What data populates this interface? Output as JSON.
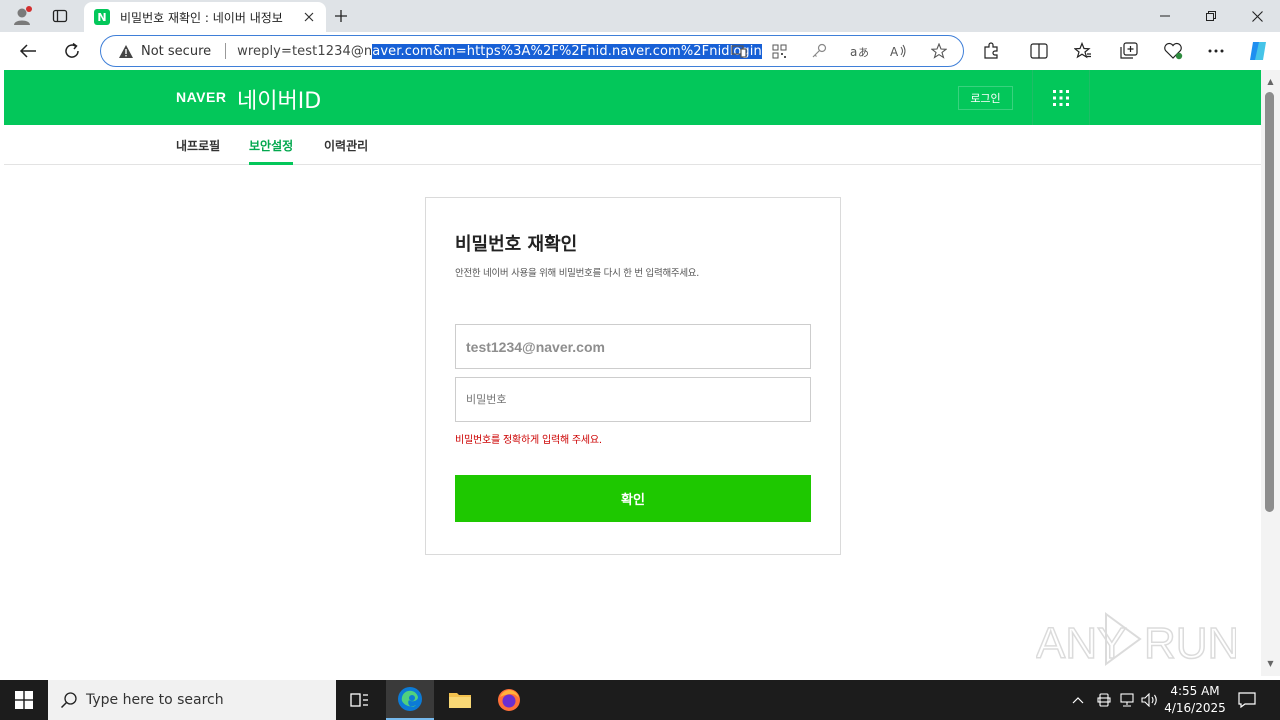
{
  "browser": {
    "tab_title": "비밀번호 재확인 : 네이버 내정보",
    "tab_favicon_letter": "N",
    "security_label": "Not secure",
    "url_plain": "wreply=test1234@n",
    "url_selected": "aver.com&m=https%3A%2F%2Fnid.naver.com%2Fnidlogin",
    "accent_color": "#1760d6"
  },
  "page": {
    "logo_text": "NAVER",
    "service_title": "네이버ID",
    "login_label": "로그인",
    "brand_color": "#03c75a",
    "subnav": [
      {
        "label": "내프로필",
        "active": false
      },
      {
        "label": "보안설정",
        "active": true
      },
      {
        "label": "이력관리",
        "active": false
      }
    ],
    "card": {
      "title": "비밀번호 재확인",
      "description": "안전한 네이버 사용을 위해 비밀번호를 다시 한 번 입력해주세요.",
      "id_value": "test1234@naver.com",
      "password_placeholder": "비밀번호",
      "error_message": "비밀번호를 정확하게 입력해 주세요.",
      "confirm_label": "확인",
      "error_color": "#cc0000",
      "button_color": "#1ec800"
    }
  },
  "watermark": {
    "text_left": "ANY",
    "text_right": "RUN"
  },
  "taskbar": {
    "search_placeholder": "Type here to search",
    "time": "4:55 AM",
    "date": "4/16/2025"
  }
}
